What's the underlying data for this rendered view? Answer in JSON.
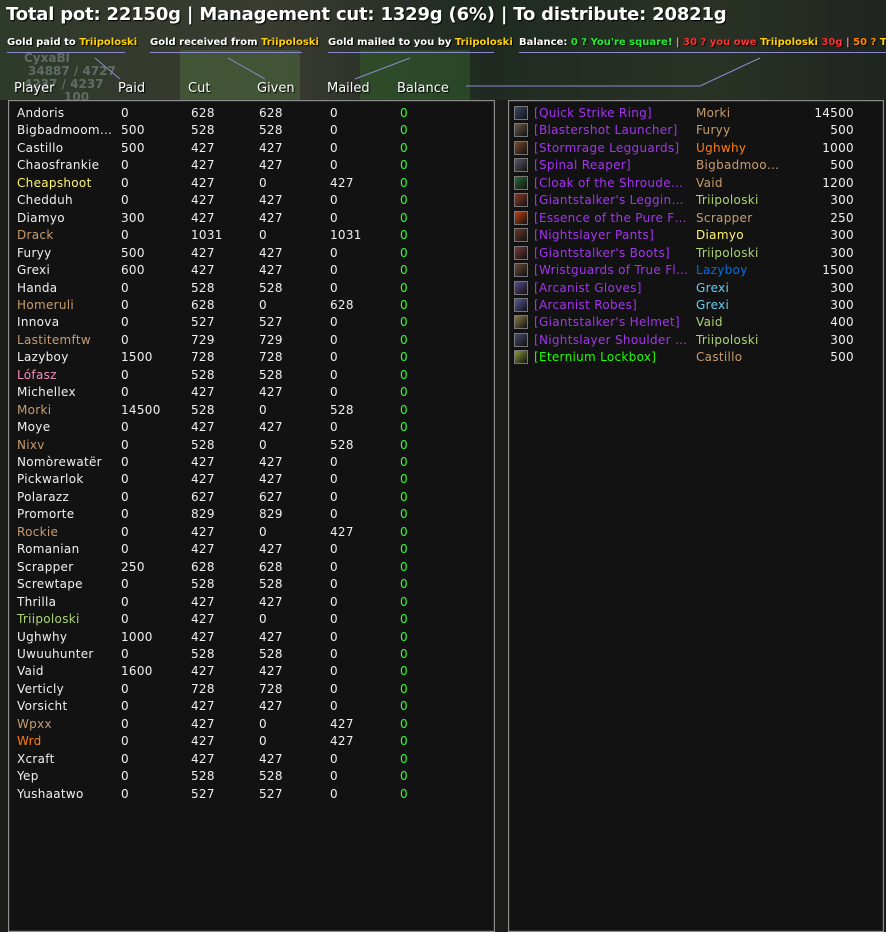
{
  "summary": {
    "title": "Total pot: 22150g | Management cut: 1329g (6%) | To distribute: 20821g"
  },
  "legend": {
    "paid_prefix": "Gold paid to ",
    "received_prefix": "Gold received from ",
    "mailed_prefix": "Gold mailed to you by ",
    "balance_prefix": "Balance: ",
    "balance_square": "0 ? You're square!",
    "sep": " | ",
    "owe_amount": "30 ? you owe ",
    "owe_gold": "30g",
    "owed_amount": "50 ? ",
    "player": "Triipoloski"
  },
  "background": {
    "ghost_name": "CyxaBl",
    "ghost_hp": "34887 / 4727",
    "ghost_stats": "4237 / 4237",
    "ghost_level": "100"
  },
  "colors": {
    "yellow_legend": "#ffd100",
    "balance_green": "#33ff33",
    "epic": "#a335ee",
    "uncommon": "#1eff00",
    "panel_border": "#8c8c8c",
    "connector_lines": "#8a8acc"
  },
  "table": {
    "headers": {
      "player": "Player",
      "paid": "Paid",
      "cut": "Cut",
      "given": "Given",
      "mailed": "Mailed",
      "balance": "Balance"
    },
    "rows": [
      {
        "name": "Andoris",
        "color": "#f0f0f0",
        "paid": "0",
        "cut": "628",
        "given": "628",
        "mailed": "0",
        "balance": "0"
      },
      {
        "name": "Bigbadmoom…",
        "color": "#f0f0f0",
        "paid": "500",
        "cut": "528",
        "given": "528",
        "mailed": "0",
        "balance": "0"
      },
      {
        "name": "Castillo",
        "color": "#f0f0f0",
        "paid": "500",
        "cut": "427",
        "given": "427",
        "mailed": "0",
        "balance": "0"
      },
      {
        "name": "Chaosfrankie",
        "color": "#f0f0f0",
        "paid": "0",
        "cut": "427",
        "given": "427",
        "mailed": "0",
        "balance": "0"
      },
      {
        "name": "Cheapshoot",
        "color": "#fff569",
        "paid": "0",
        "cut": "427",
        "given": "0",
        "mailed": "427",
        "balance": "0"
      },
      {
        "name": "Chedduh",
        "color": "#f0f0f0",
        "paid": "0",
        "cut": "427",
        "given": "427",
        "mailed": "0",
        "balance": "0"
      },
      {
        "name": "Diamyo",
        "color": "#f0f0f0",
        "paid": "300",
        "cut": "427",
        "given": "427",
        "mailed": "0",
        "balance": "0"
      },
      {
        "name": "Drack",
        "color": "#c79c6e",
        "paid": "0",
        "cut": "1031",
        "given": "0",
        "mailed": "1031",
        "balance": "0"
      },
      {
        "name": "Furyy",
        "color": "#f0f0f0",
        "paid": "500",
        "cut": "427",
        "given": "427",
        "mailed": "0",
        "balance": "0"
      },
      {
        "name": "Grexi",
        "color": "#f0f0f0",
        "paid": "600",
        "cut": "427",
        "given": "427",
        "mailed": "0",
        "balance": "0"
      },
      {
        "name": "Handa",
        "color": "#f0f0f0",
        "paid": "0",
        "cut": "528",
        "given": "528",
        "mailed": "0",
        "balance": "0"
      },
      {
        "name": "Homeruli",
        "color": "#c79c6e",
        "paid": "0",
        "cut": "628",
        "given": "0",
        "mailed": "628",
        "balance": "0"
      },
      {
        "name": "Innova",
        "color": "#f0f0f0",
        "paid": "0",
        "cut": "527",
        "given": "527",
        "mailed": "0",
        "balance": "0"
      },
      {
        "name": "Lastitemftw",
        "color": "#c79c6e",
        "paid": "0",
        "cut": "729",
        "given": "729",
        "mailed": "0",
        "balance": "0"
      },
      {
        "name": "Lazyboy",
        "color": "#f0f0f0",
        "paid": "1500",
        "cut": "728",
        "given": "728",
        "mailed": "0",
        "balance": "0"
      },
      {
        "name": "Lófasz",
        "color": "#f58cba",
        "paid": "0",
        "cut": "528",
        "given": "528",
        "mailed": "0",
        "balance": "0"
      },
      {
        "name": "Michellex",
        "color": "#f0f0f0",
        "paid": "0",
        "cut": "427",
        "given": "427",
        "mailed": "0",
        "balance": "0"
      },
      {
        "name": "Morki",
        "color": "#c79c6e",
        "paid": "14500",
        "cut": "528",
        "given": "0",
        "mailed": "528",
        "balance": "0"
      },
      {
        "name": "Moye",
        "color": "#f0f0f0",
        "paid": "0",
        "cut": "427",
        "given": "427",
        "mailed": "0",
        "balance": "0"
      },
      {
        "name": "Nixv",
        "color": "#c79c6e",
        "paid": "0",
        "cut": "528",
        "given": "0",
        "mailed": "528",
        "balance": "0"
      },
      {
        "name": "Nomòrewatër",
        "color": "#f0f0f0",
        "paid": "0",
        "cut": "427",
        "given": "427",
        "mailed": "0",
        "balance": "0"
      },
      {
        "name": "Pickwarlok",
        "color": "#f0f0f0",
        "paid": "0",
        "cut": "427",
        "given": "427",
        "mailed": "0",
        "balance": "0"
      },
      {
        "name": "Polarazz",
        "color": "#f0f0f0",
        "paid": "0",
        "cut": "627",
        "given": "627",
        "mailed": "0",
        "balance": "0"
      },
      {
        "name": "Promorte",
        "color": "#f0f0f0",
        "paid": "0",
        "cut": "829",
        "given": "829",
        "mailed": "0",
        "balance": "0"
      },
      {
        "name": "Rockie",
        "color": "#c79c6e",
        "paid": "0",
        "cut": "427",
        "given": "0",
        "mailed": "427",
        "balance": "0"
      },
      {
        "name": "Romanian",
        "color": "#f0f0f0",
        "paid": "0",
        "cut": "427",
        "given": "427",
        "mailed": "0",
        "balance": "0"
      },
      {
        "name": "Scrapper",
        "color": "#f0f0f0",
        "paid": "250",
        "cut": "628",
        "given": "628",
        "mailed": "0",
        "balance": "0"
      },
      {
        "name": "Screwtape",
        "color": "#f0f0f0",
        "paid": "0",
        "cut": "528",
        "given": "528",
        "mailed": "0",
        "balance": "0"
      },
      {
        "name": "Thrilla",
        "color": "#f0f0f0",
        "paid": "0",
        "cut": "427",
        "given": "427",
        "mailed": "0",
        "balance": "0"
      },
      {
        "name": "Triipoloski",
        "color": "#abd473",
        "paid": "0",
        "cut": "427",
        "given": "0",
        "mailed": "0",
        "balance": "0"
      },
      {
        "name": "Ughwhy",
        "color": "#f0f0f0",
        "paid": "1000",
        "cut": "427",
        "given": "427",
        "mailed": "0",
        "balance": "0"
      },
      {
        "name": "Uwuuhunter",
        "color": "#f0f0f0",
        "paid": "0",
        "cut": "528",
        "given": "528",
        "mailed": "0",
        "balance": "0"
      },
      {
        "name": "Vaid",
        "color": "#f0f0f0",
        "paid": "1600",
        "cut": "427",
        "given": "427",
        "mailed": "0",
        "balance": "0"
      },
      {
        "name": "Verticly",
        "color": "#f0f0f0",
        "paid": "0",
        "cut": "728",
        "given": "728",
        "mailed": "0",
        "balance": "0"
      },
      {
        "name": "Vorsicht",
        "color": "#f0f0f0",
        "paid": "0",
        "cut": "427",
        "given": "427",
        "mailed": "0",
        "balance": "0"
      },
      {
        "name": "Wpxx",
        "color": "#c79c6e",
        "paid": "0",
        "cut": "427",
        "given": "0",
        "mailed": "427",
        "balance": "0"
      },
      {
        "name": "Wrd",
        "color": "#ff7d0a",
        "paid": "0",
        "cut": "427",
        "given": "0",
        "mailed": "427",
        "balance": "0"
      },
      {
        "name": "Xcraft",
        "color": "#f0f0f0",
        "paid": "0",
        "cut": "427",
        "given": "427",
        "mailed": "0",
        "balance": "0"
      },
      {
        "name": "Yep",
        "color": "#f0f0f0",
        "paid": "0",
        "cut": "528",
        "given": "528",
        "mailed": "0",
        "balance": "0"
      },
      {
        "name": "Yushaatwo",
        "color": "#f0f0f0",
        "paid": "0",
        "cut": "527",
        "given": "527",
        "mailed": "0",
        "balance": "0"
      }
    ]
  },
  "loot": {
    "rows": [
      {
        "item": "[Quick Strike Ring]",
        "item_color": "#a335ee",
        "icon": "ring-icon",
        "icon_color": "#3a4a6a",
        "winner": "Morki",
        "winner_color": "#c79c6e",
        "price": "14500"
      },
      {
        "item": "[Blastershot Launcher]",
        "item_color": "#a335ee",
        "icon": "gun-icon",
        "icon_color": "#6a5a4a",
        "winner": "Furyy",
        "winner_color": "#c79c6e",
        "price": "500"
      },
      {
        "item": "[Stormrage Legguards]",
        "item_color": "#a335ee",
        "icon": "legs-icon",
        "icon_color": "#7a4a2a",
        "winner": "Ughwhy",
        "winner_color": "#ff7d0a",
        "price": "1000"
      },
      {
        "item": "[Spinal Reaper]",
        "item_color": "#a335ee",
        "icon": "axe-icon",
        "icon_color": "#5a5a6a",
        "winner": "Bigbadmoo…",
        "winner_color": "#c79c6e",
        "price": "500"
      },
      {
        "item": "[Cloak of the Shrouded…",
        "item_color": "#a335ee",
        "icon": "cloak-icon",
        "icon_color": "#2a6a3a",
        "winner": "Vaid",
        "winner_color": "#c79c6e",
        "price": "1200"
      },
      {
        "item": "[Giantstalker's Leggings]",
        "item_color": "#a335ee",
        "icon": "legs-icon",
        "icon_color": "#8a3a2a",
        "winner": "Triipoloski",
        "winner_color": "#abd473",
        "price": "300"
      },
      {
        "item": "[Essence of the Pure Fl…",
        "item_color": "#a335ee",
        "icon": "flame-icon",
        "icon_color": "#c04010",
        "winner": "Scrapper",
        "winner_color": "#c79c6e",
        "price": "250"
      },
      {
        "item": "[Nightslayer Pants]",
        "item_color": "#a335ee",
        "icon": "legs-icon",
        "icon_color": "#6a3a2a",
        "winner": "Diamyo",
        "winner_color": "#fff569",
        "price": "300"
      },
      {
        "item": "[Giantstalker's Boots]",
        "item_color": "#a335ee",
        "icon": "boots-icon",
        "icon_color": "#7a3a3a",
        "winner": "Triipoloski",
        "winner_color": "#abd473",
        "price": "300"
      },
      {
        "item": "[Wristguards of True Fl…",
        "item_color": "#a335ee",
        "icon": "wrist-icon",
        "icon_color": "#6a4a3a",
        "winner": "Lazyboy",
        "winner_color": "#0070de",
        "price": "1500"
      },
      {
        "item": "[Arcanist Gloves]",
        "item_color": "#a335ee",
        "icon": "gloves-icon",
        "icon_color": "#5a4a8a",
        "winner": "Grexi",
        "winner_color": "#69ccf0",
        "price": "300"
      },
      {
        "item": "[Arcanist Robes]",
        "item_color": "#a335ee",
        "icon": "robe-icon",
        "icon_color": "#5a5a9a",
        "winner": "Grexi",
        "winner_color": "#69ccf0",
        "price": "300"
      },
      {
        "item": "[Giantstalker's Helmet]",
        "item_color": "#a335ee",
        "icon": "helm-icon",
        "icon_color": "#8a7a4a",
        "winner": "Vaid",
        "winner_color": "#abd473",
        "price": "400"
      },
      {
        "item": "[Nightslayer Shoulder P…",
        "item_color": "#a335ee",
        "icon": "shoulder-icon",
        "icon_color": "#4a4a6a",
        "winner": "Triipoloski",
        "winner_color": "#abd473",
        "price": "300"
      },
      {
        "item": "[Eternium Lockbox]",
        "item_color": "#1eff00",
        "icon": "lockbox-icon",
        "icon_color": "#8a9a3a",
        "winner": "Castillo",
        "winner_color": "#c79c6e",
        "price": "500"
      }
    ]
  }
}
